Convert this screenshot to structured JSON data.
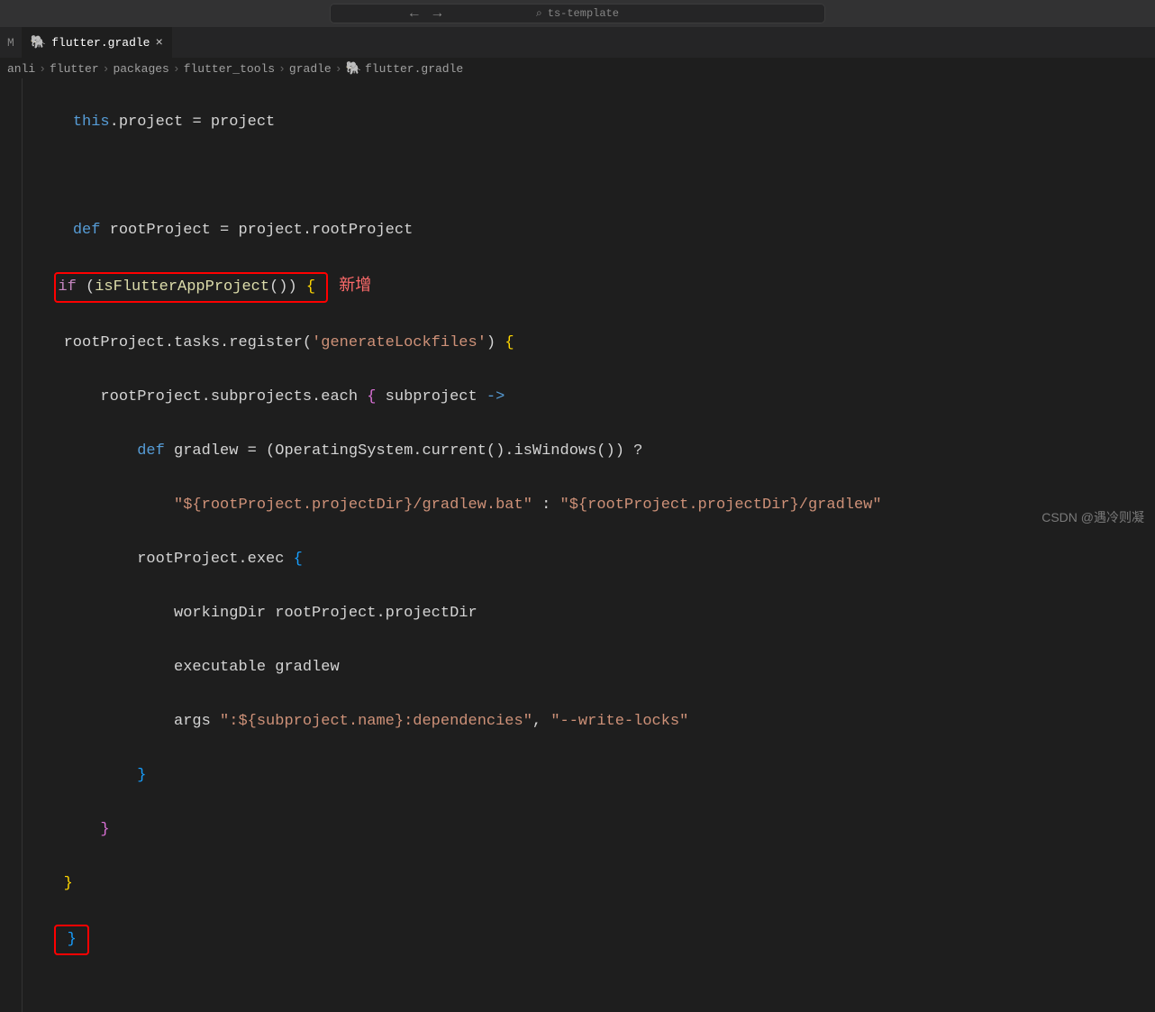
{
  "titleBar": {
    "searchPlaceholder": "ts-template"
  },
  "tabs": {
    "prefix": "M",
    "active": {
      "label": "flutter.gradle",
      "icon": "gradle"
    }
  },
  "breadcrumb": {
    "items": [
      "anli",
      "flutter",
      "packages",
      "flutter_tools",
      "gradle",
      "flutter.gradle"
    ]
  },
  "code": {
    "line1_this": "this",
    "line1_dot": ".",
    "line1_project": "project = project",
    "line3_def": "def",
    "line3_rest": " rootProject = project.rootProject",
    "line4_if": "if",
    "line4_open": " (",
    "line4_func": "isFlutterAppProject",
    "line4_close": "()) ",
    "line4_brace": "{",
    "annotation_new": "新增",
    "line5": "rootProject.tasks.register(",
    "line5_str": "'generateLockfiles'",
    "line5_close": ") ",
    "line5_brace": "{",
    "line6_a": "rootProject.subprojects.each ",
    "line6_brace": "{",
    "line6_b": " subproject ",
    "line6_arrow": "->",
    "line7_def": "def",
    "line7_a": " gradlew = (OperatingSystem.current().isWindows()) ?",
    "line8_str1": "\"${rootProject.projectDir}/gradlew.bat\"",
    "line8_mid": " : ",
    "line8_str2": "\"${rootProject.projectDir}/gradlew\"",
    "line9": "rootProject.exec ",
    "line9_brace": "{",
    "line10": "workingDir rootProject.projectDir",
    "line11": "executable gradlew",
    "line12_a": "args ",
    "line12_str1": "\":${subproject.name}:dependencies\"",
    "line12_mid": ", ",
    "line12_str2": "\"--write-locks\"",
    "brace_close": "}"
  },
  "watermark": "CSDN @遇冷则凝"
}
